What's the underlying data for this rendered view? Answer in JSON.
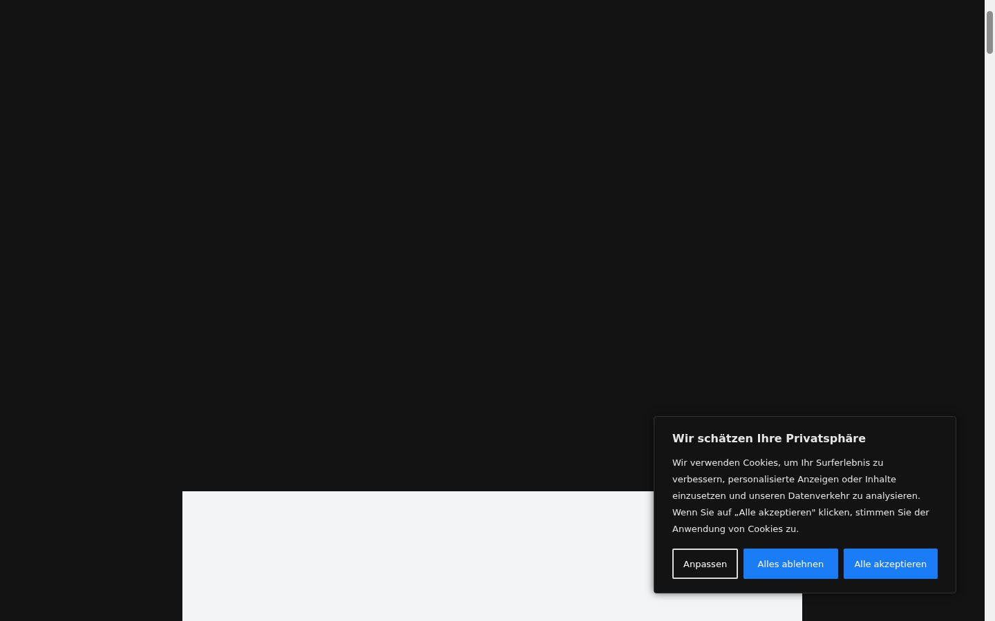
{
  "cookie_dialog": {
    "title": "Wir schätzen Ihre Privatsphäre",
    "text": "Wir verwenden Cookies, um Ihr Surferlebnis zu verbessern, personalisierte Anzeigen oder Inhalte einzusetzen und unseren Datenverkehr zu analysieren. Wenn Sie auf „Alle akzeptieren\" klicken, stimmen Sie der Anwendung von Cookies zu.",
    "buttons": [
      {
        "label": "Anpassen",
        "kind": "outline"
      },
      {
        "label": "Alles ablehnen",
        "kind": "primary"
      },
      {
        "label": "Alle akzeptieren",
        "kind": "primary"
      }
    ]
  }
}
